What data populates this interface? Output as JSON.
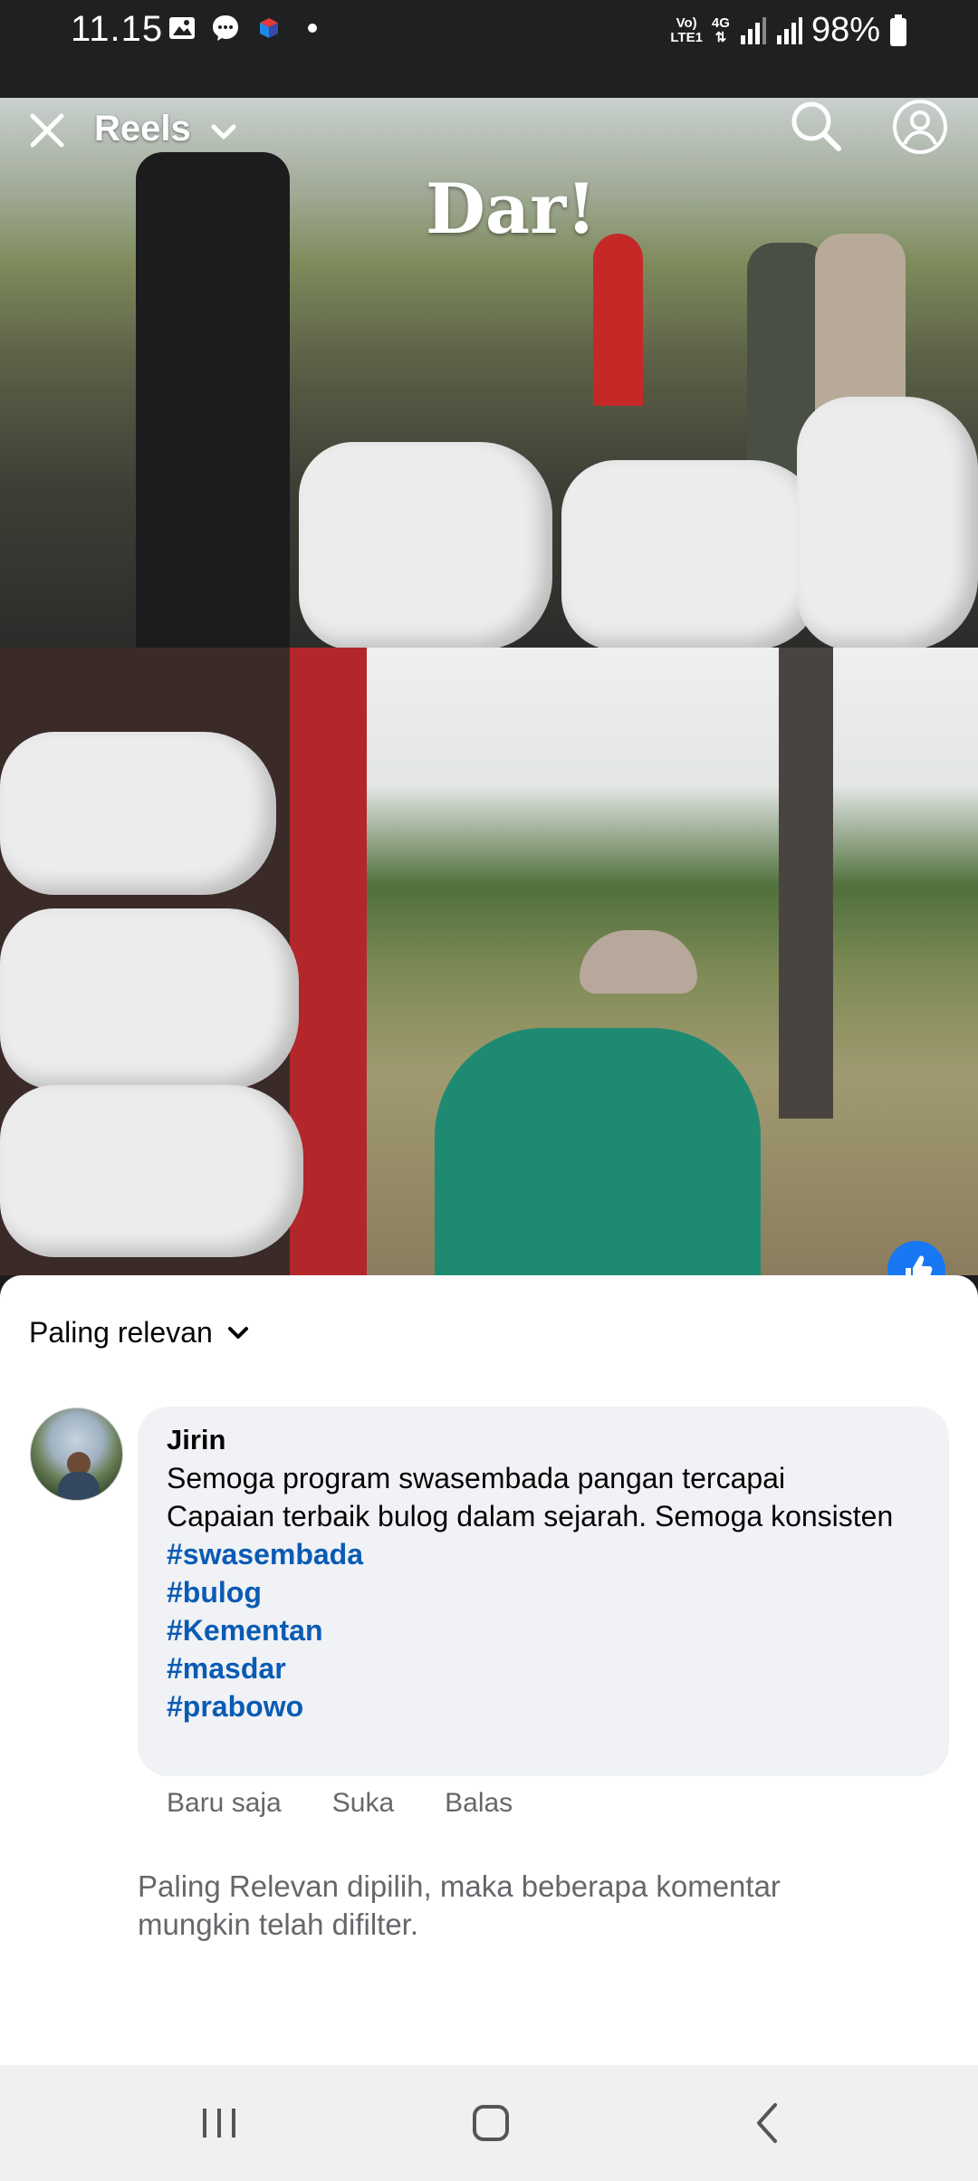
{
  "status_bar": {
    "time": "11.15",
    "network_top": "Vo)",
    "network_bottom": "LTE1",
    "network_type": "4G",
    "battery": "98%"
  },
  "reels": {
    "title": "Reels",
    "overlay_text": "Dar!"
  },
  "comments": {
    "sort_label": "Paling relevan",
    "items": [
      {
        "author": "Jirin",
        "text_line1": "Semoga program swasembada pangan tercapai",
        "text_line2": "Capaian terbaik bulog dalam sejarah. Semoga konsisten",
        "hashtags": [
          "#swasembada",
          "#bulog",
          "#Kementan",
          "#masdar",
          "#prabowo"
        ],
        "time": "Baru saja",
        "like_label": "Suka",
        "reply_label": "Balas"
      }
    ],
    "filter_note": "Paling Relevan dipilih, maka beberapa komentar mungkin telah difilter."
  },
  "colors": {
    "hashtag": "#0a5bb4",
    "bubble": "#f0f2f5",
    "meta_text": "#65676b",
    "like_fab": "#1877f2"
  }
}
